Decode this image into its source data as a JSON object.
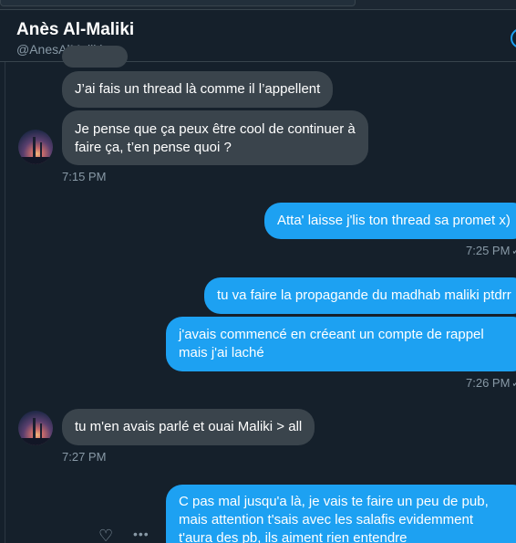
{
  "header": {
    "name": "Anès Al-Maliki",
    "handle": "@AnesAlMaliki"
  },
  "messages": [
    {
      "text": "J’ai fais un thread là comme il l’appellent"
    },
    {
      "line1": "Je pense que ça peux être cool de continuer à",
      "line2": "faire ça, t’en pense quoi ?"
    },
    {
      "text": "Atta' laisse j'lis ton thread sa promet x)"
    },
    {
      "text": "tu va faire la propagande du madhab maliki ptdrr"
    },
    {
      "line1": "j'avais commencé en créeant un compte de rappel",
      "line2": "mais j'ai laché"
    },
    {
      "text": "tu m'en avais parlé et ouai Maliki > all"
    },
    {
      "line1": "C pas mal jusqu'a là, je vais te faire un peu de pub,",
      "line2": "mais attention t'sais avec les salafis evidemment",
      "line3": "t'aura des pb, ils aiment rien entendre"
    }
  ],
  "timestamps": {
    "t1": "7:15 PM",
    "t2": "7:25 PM",
    "t3": "7:26 PM",
    "t4": "7:27 PM"
  },
  "icons": {
    "like": "heart-icon",
    "more": "more-icon",
    "info": "info-icon"
  },
  "colors": {
    "background": "#15202b",
    "incoming_bubble": "#3a444c",
    "outgoing_bubble": "#1da1f2",
    "secondary_text": "#8899a6"
  }
}
